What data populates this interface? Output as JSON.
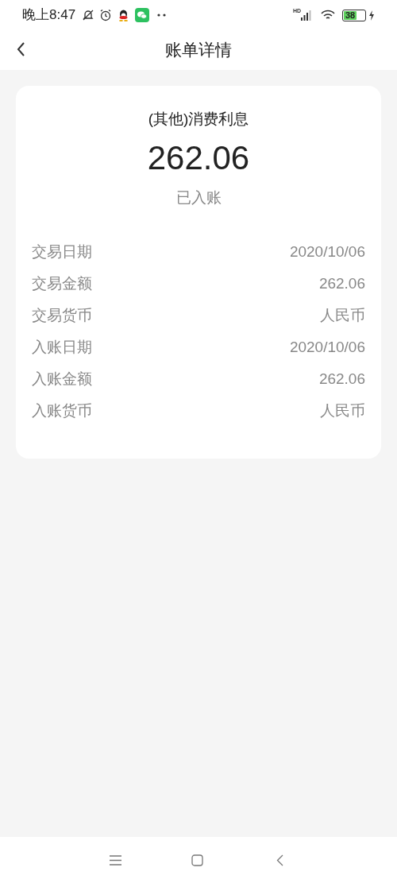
{
  "status_bar": {
    "time": "晚上8:47",
    "network": "HD",
    "battery": "38"
  },
  "header": {
    "title": "账单详情"
  },
  "bill": {
    "type": "(其他)消费利息",
    "amount": "262.06",
    "status": "已入账",
    "rows": [
      {
        "label": "交易日期",
        "value": "2020/10/06"
      },
      {
        "label": "交易金额",
        "value": "262.06"
      },
      {
        "label": "交易货币",
        "value": "人民币"
      },
      {
        "label": "入账日期",
        "value": "2020/10/06"
      },
      {
        "label": "入账金额",
        "value": "262.06"
      },
      {
        "label": "入账货币",
        "value": "人民币"
      }
    ]
  }
}
